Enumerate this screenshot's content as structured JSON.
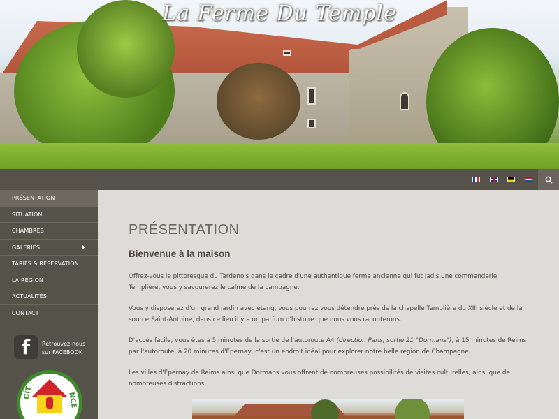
{
  "header": {
    "site_title": "La Ferme Du Temple"
  },
  "topbar": {
    "languages": [
      {
        "code": "fr",
        "icon": "flag-france-icon"
      },
      {
        "code": "en",
        "icon": "flag-uk-icon"
      },
      {
        "code": "de",
        "icon": "flag-germany-icon"
      },
      {
        "code": "nl",
        "icon": "flag-netherlands-icon"
      }
    ],
    "search_icon": "search-icon"
  },
  "sidebar": {
    "items": [
      {
        "label": "PRÉSENTATION",
        "active": true
      },
      {
        "label": "SITUATION"
      },
      {
        "label": "CHAMBRES"
      },
      {
        "label": "GALERIES",
        "has_submenu": true
      },
      {
        "label": "TARIFS & RÉSERVATION"
      },
      {
        "label": "LA RÉGION"
      },
      {
        "label": "ACTUALITÉS"
      },
      {
        "label": "CONTACT"
      }
    ],
    "facebook": {
      "icon": "facebook-icon",
      "line1": "Retrouvez-nous",
      "line2": "sur FACEBOOK"
    },
    "badge": {
      "text_left": "GÎT",
      "text_right": "NCE"
    }
  },
  "main": {
    "page_title": "PRÉSENTATION",
    "subtitle": "Bienvenue à la maison",
    "paragraphs": [
      "Offrez-vous le pittoresque du Tardenois dans le cadre d'une authentique ferme ancienne qui fut jadis une commanderie Templière, vous y savourerez le calme de la campagne.",
      "Vous y disposerez d'un grand jardin avec étang, vous pourrez vous détendre près de la chapelle Templière du XIII siècle et de la source Saint-Antoine, dans ce lieu il y a un parfum d'histoire que nous vous raconterons.",
      {
        "before": "D'accès facile, vous êtes à 5 minutes de la sortie de l'autoroute A4 ",
        "italic": "(direction Paris, sortie 21 \"Dormans\")",
        "after": ", à 15 minutes de Reims par l'autoroute, à 20 minutes d'Epernay, c'est un endroit idéal pour explorer notre belle région de Champagne."
      },
      "Les villes d'Epernay de Reims ainsi que Dormans vous offrent de nombreuses possibilités de visites culturelles, ainsi que de nombreuses distractions."
    ]
  },
  "colors": {
    "nav_bg": "#55524a",
    "content_bg": "#dedcd8",
    "title_color": "#6b675f"
  }
}
